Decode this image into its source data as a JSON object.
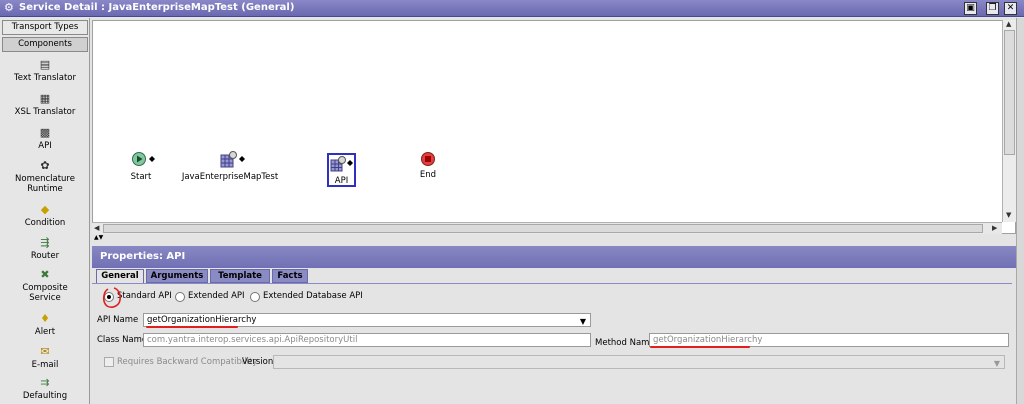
{
  "window": {
    "title": "Service Detail : JavaEnterpriseMapTest (General)",
    "buttons": [
      "save-icon",
      "restore-icon",
      "close-icon"
    ]
  },
  "sidebar": {
    "tabs": [
      {
        "label": "Transport Types"
      },
      {
        "label": "Components"
      }
    ],
    "components": [
      {
        "label": "Text Translator",
        "icon": "text-translator-icon"
      },
      {
        "label": "XSL Translator",
        "icon": "xsl-translator-icon"
      },
      {
        "label": "API",
        "icon": "api-icon"
      },
      {
        "label": "Nomenclature Runtime",
        "line1": "Nomenclature",
        "line2": "Runtime",
        "icon": "nomenclature-icon"
      },
      {
        "label": "Condition",
        "icon": "condition-icon"
      },
      {
        "label": "Router",
        "icon": "router-icon"
      },
      {
        "label": "Composite Service",
        "line1": "Composite",
        "line2": "Service",
        "icon": "composite-service-icon"
      },
      {
        "label": "Alert",
        "icon": "alert-icon"
      },
      {
        "label": "E-mail",
        "icon": "email-icon"
      },
      {
        "label": "Defaulting",
        "icon": "defaulting-icon"
      }
    ]
  },
  "canvas": {
    "nodes": [
      {
        "label": "Start",
        "icon": "start-icon"
      },
      {
        "label": "JavaEnterpriseMapTest",
        "icon": "service-icon"
      },
      {
        "label": "API",
        "icon": "api-icon",
        "selected": true
      },
      {
        "label": "End",
        "icon": "end-icon"
      }
    ]
  },
  "properties": {
    "header": "Properties: API",
    "tabs": [
      {
        "label": "General",
        "active": true
      },
      {
        "label": "Arguments"
      },
      {
        "label": "Template"
      },
      {
        "label": "Facts"
      }
    ],
    "radios": [
      {
        "label": "Standard API",
        "selected": true
      },
      {
        "label": "Extended API"
      },
      {
        "label": "Extended Database API"
      }
    ],
    "api_name_label": "API Name",
    "api_name_value": "getOrganizationHierarchy",
    "class_name_label": "Class Name",
    "class_name_value": "com.yantra.interop.services.api.ApiRepositoryUtil",
    "method_name_label": "Method Name",
    "method_name_value": "getOrganizationHierarchy",
    "compat_label": "Requires Backward Compatibility",
    "version_label": "Version",
    "version_value": ""
  },
  "colors": {
    "title_bar": "#7a78bc",
    "props_header": "#7c7cbc",
    "annotation": "#e0201c",
    "selected_node_border": "#3030c0"
  }
}
